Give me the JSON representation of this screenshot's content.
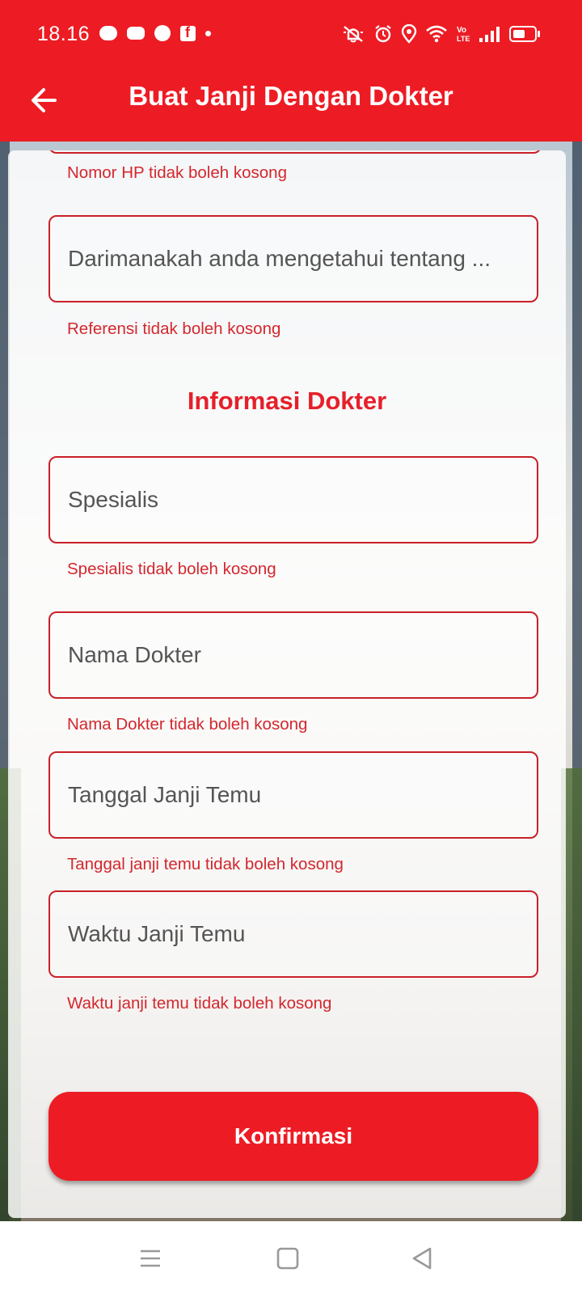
{
  "status_bar": {
    "time": "18.16",
    "notification_icons": [
      "line-icon",
      "game-controller-icon",
      "messenger-icon",
      "facebook-icon",
      "dot-icon"
    ],
    "system_icons": [
      "mute-icon",
      "alarm-icon",
      "location-icon",
      "wifi-icon",
      "volte-icon",
      "signal-icon",
      "battery-icon"
    ]
  },
  "header": {
    "title": "Buat Janji Dengan Dokter",
    "back_icon": "arrow-left-icon"
  },
  "form": {
    "phone_error": "Nomor HP tidak boleh kosong",
    "referral_placeholder": "Darimanakah anda mengetahui tentang ...",
    "referral_error": "Referensi tidak boleh kosong",
    "section_title": "Informasi Dokter",
    "specialist_placeholder": "Spesialis",
    "specialist_error": "Spesialis tidak boleh kosong",
    "doctor_placeholder": "Nama Dokter",
    "doctor_error": "Nama Dokter tidak boleh kosong",
    "date_placeholder": "Tanggal Janji Temu",
    "date_error": "Tanggal janji temu tidak boleh kosong",
    "time_placeholder": "Waktu Janji Temu",
    "time_error": "Waktu janji temu tidak boleh kosong",
    "confirm_label": "Konfirmasi"
  },
  "nav_bar": {
    "buttons": [
      "menu-icon",
      "home-square-icon",
      "back-triangle-icon"
    ]
  },
  "colors": {
    "primary": "#ed1c24",
    "error": "#d3282e",
    "border": "#c92028"
  }
}
